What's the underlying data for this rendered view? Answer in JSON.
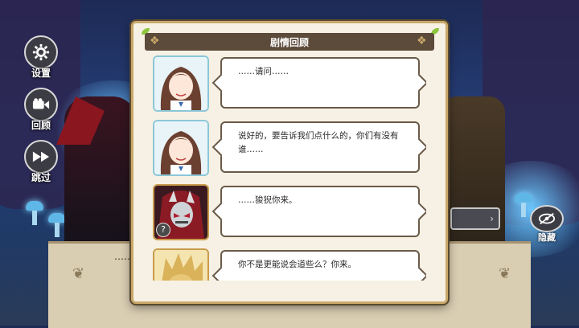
{
  "side_buttons": [
    {
      "label": "设置",
      "icon": "gear-icon"
    },
    {
      "label": "回顾",
      "icon": "camera-icon"
    },
    {
      "label": "跳过",
      "icon": "fast-forward-icon"
    }
  ],
  "hide_button": {
    "label": "隐藏",
    "icon": "eye-slash-icon"
  },
  "ground_dots": "……",
  "dialog": {
    "title": "剧情回顾",
    "entries": [
      {
        "speaker_icon": "brown-hair-girl-avatar",
        "text": "……请问……"
      },
      {
        "speaker_icon": "brown-hair-girl-avatar",
        "text": "说好的，要告诉我们点什么的，你们有没有谁……"
      },
      {
        "speaker_icon": "masked-hooded-villain-avatar",
        "text": "……狻猊你来。",
        "badge": "?"
      },
      {
        "speaker_icon": "golden-lion-avatar",
        "text": "你不是更能说会道些么？你来。"
      }
    ]
  },
  "colors": {
    "panel_bg": "#f6f1e4",
    "panel_border": "#c9a86a",
    "title_bar": "#5c4a3a",
    "bubble_border": "#6a5a48"
  }
}
